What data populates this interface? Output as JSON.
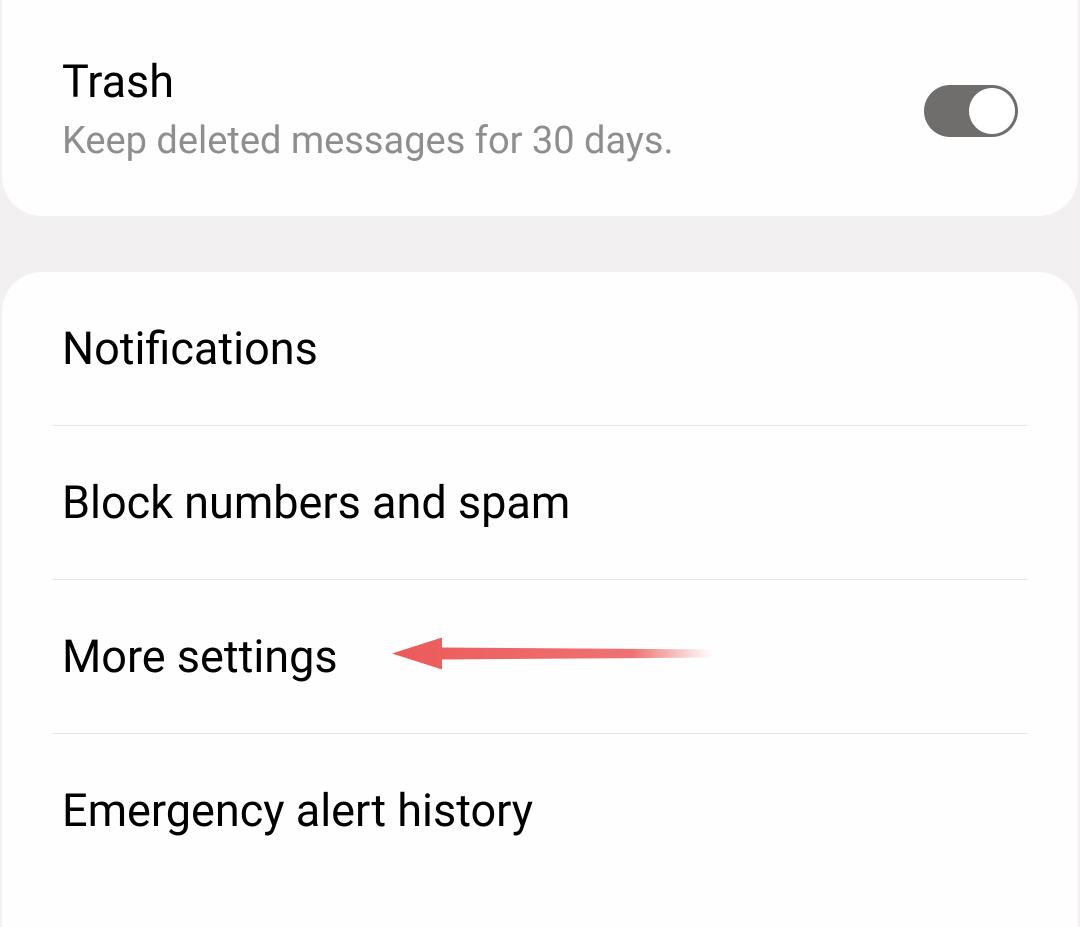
{
  "trash": {
    "title": "Trash",
    "description": "Keep deleted messages for 30 days.",
    "toggle_on": true
  },
  "menu": {
    "items": [
      {
        "label": "Notifications"
      },
      {
        "label": "Block numbers and spam"
      },
      {
        "label": "More settings"
      },
      {
        "label": "Emergency alert history"
      }
    ]
  },
  "annotation": {
    "target_index": 2,
    "type": "arrow-left",
    "color": "#ec5a5a"
  }
}
